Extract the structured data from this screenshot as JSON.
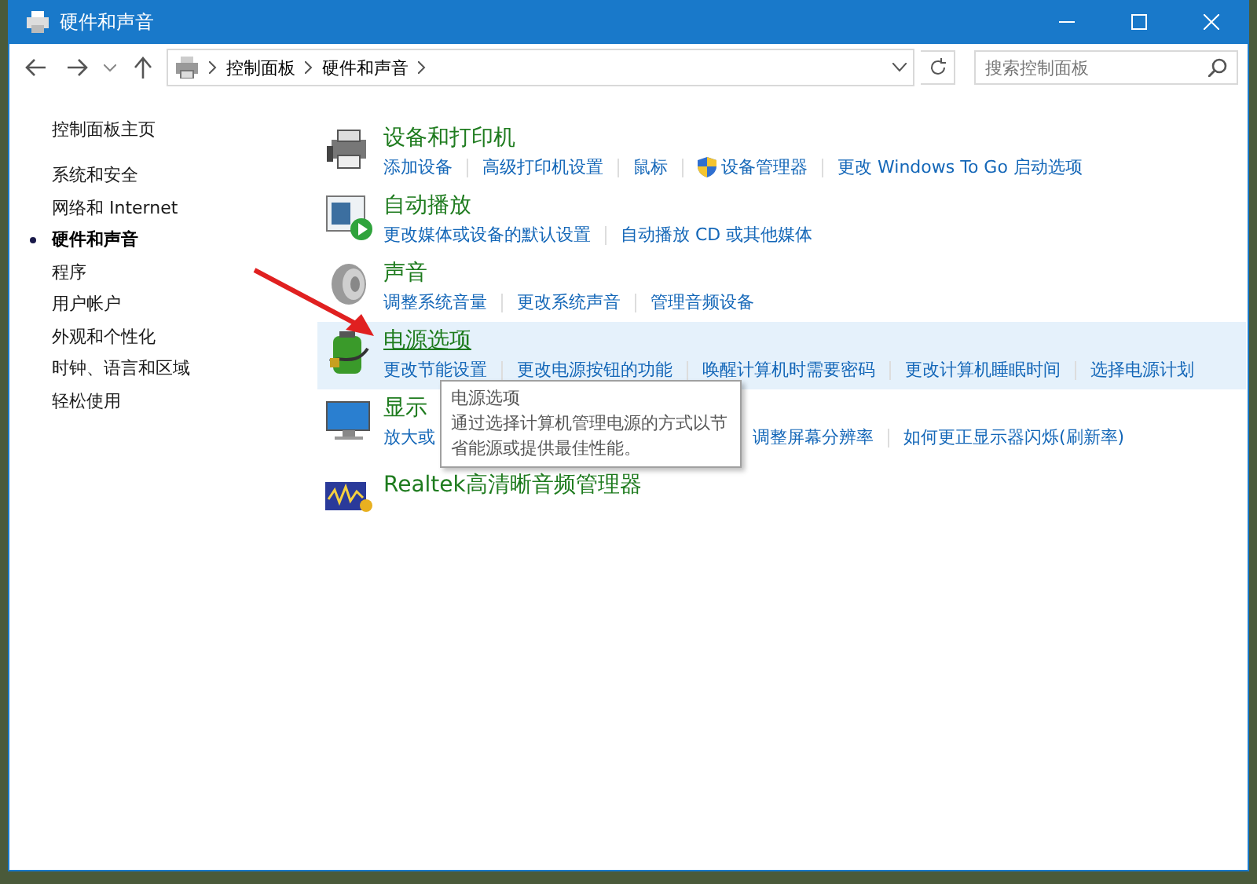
{
  "window": {
    "title": "硬件和声音"
  },
  "address": {
    "crumbs": [
      "控制面板",
      "硬件和声音"
    ]
  },
  "search": {
    "placeholder": "搜索控制面板"
  },
  "sidebar": {
    "home": "控制面板主页",
    "items": [
      {
        "label": "系统和安全",
        "selected": false
      },
      {
        "label": "网络和 Internet",
        "selected": false
      },
      {
        "label": "硬件和声音",
        "selected": true
      },
      {
        "label": "程序",
        "selected": false
      },
      {
        "label": "用户帐户",
        "selected": false
      },
      {
        "label": "外观和个性化",
        "selected": false
      },
      {
        "label": "时钟、语言和区域",
        "selected": false
      },
      {
        "label": "轻松使用",
        "selected": false
      }
    ]
  },
  "categories": [
    {
      "kind": "printer",
      "title": "设备和打印机",
      "hovered": false,
      "links": [
        {
          "label": "添加设备",
          "shield": false
        },
        {
          "label": "高级打印机设置",
          "shield": false
        },
        {
          "label": "鼠标",
          "shield": false
        },
        {
          "label": "设备管理器",
          "shield": true
        },
        {
          "label": "更改 Windows To Go 启动选项",
          "shield": false
        }
      ]
    },
    {
      "kind": "autoplay",
      "title": "自动播放",
      "hovered": false,
      "links": [
        {
          "label": "更改媒体或设备的默认设置",
          "shield": false
        },
        {
          "label": "自动播放 CD 或其他媒体",
          "shield": false
        }
      ]
    },
    {
      "kind": "sound",
      "title": "声音",
      "hovered": false,
      "links": [
        {
          "label": "调整系统音量",
          "shield": false
        },
        {
          "label": "更改系统声音",
          "shield": false
        },
        {
          "label": "管理音频设备",
          "shield": false
        }
      ]
    },
    {
      "kind": "power",
      "title": "电源选项",
      "hovered": true,
      "links": [
        {
          "label": "更改节能设置",
          "shield": false
        },
        {
          "label": "更改电源按钮的功能",
          "shield": false
        },
        {
          "label": "唤醒计算机时需要密码",
          "shield": false
        },
        {
          "label": "更改计算机睡眠时间",
          "shield": false
        },
        {
          "label": "选择电源计划",
          "shield": false
        }
      ]
    },
    {
      "kind": "display",
      "title": "显示",
      "hovered": false,
      "links": [
        {
          "label": "放大或",
          "shield": false
        },
        {
          "label": "调整屏幕分辨率",
          "shield": false
        },
        {
          "label": "如何更正显示器闪烁(刷新率)",
          "shield": false
        }
      ]
    },
    {
      "kind": "audio",
      "title": "Realtek高清晰音频管理器",
      "hovered": false
    }
  ],
  "tooltip": {
    "title": "电源选项",
    "text": "通过选择计算机管理电源的方式以节省能源或提供最佳性能。"
  }
}
